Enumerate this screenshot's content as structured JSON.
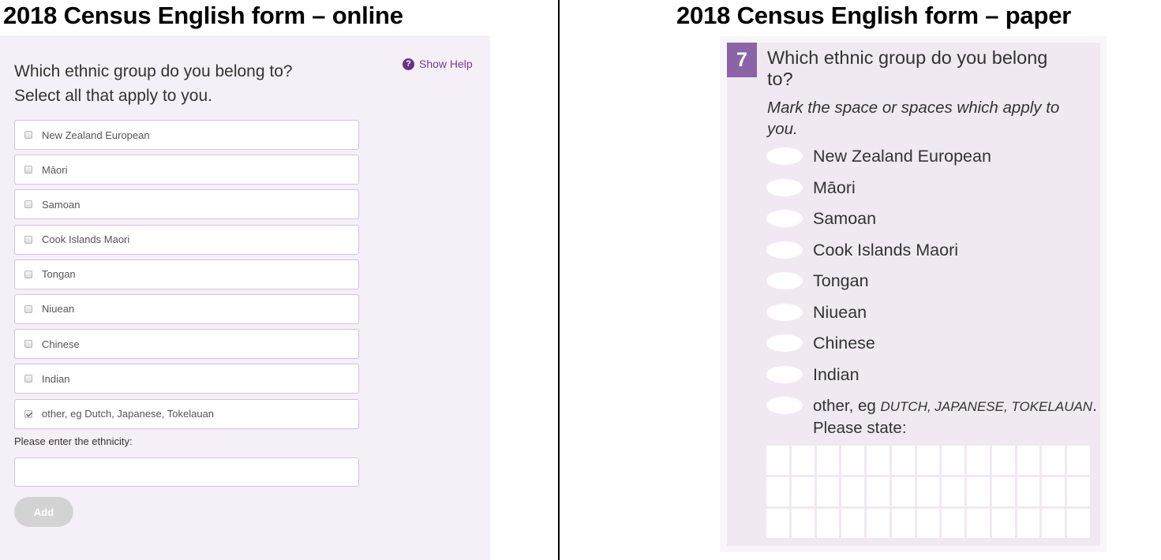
{
  "online": {
    "heading": "2018 Census English form – online",
    "question_line1": "Which ethnic group do you belong to?",
    "question_line2": "Select all that apply to you.",
    "help_label": "Show Help",
    "help_icon": "question-circle-icon",
    "options": [
      {
        "label": "New Zealand European",
        "checked": false
      },
      {
        "label": "Māori",
        "checked": false
      },
      {
        "label": "Samoan",
        "checked": false
      },
      {
        "label": "Cook Islands Maori",
        "checked": false
      },
      {
        "label": "Tongan",
        "checked": false
      },
      {
        "label": "Niuean",
        "checked": false
      },
      {
        "label": "Chinese",
        "checked": false
      },
      {
        "label": "Indian",
        "checked": false
      },
      {
        "label": "other, eg Dutch, Japanese, Tokelauan",
        "checked": true
      }
    ],
    "enter_label": "Please enter the ethnicity:",
    "ethnicity_value": "",
    "ethnicity_placeholder": "",
    "add_button": "Add",
    "colors": {
      "background": "#f5f0f7",
      "accent": "#6b2f8a",
      "border": "#d7c2e0",
      "button_disabled": "#d3d3d3"
    }
  },
  "paper": {
    "heading": "2018 Census English form – paper",
    "question_number": "7",
    "question": "Which ethnic group do you belong to?",
    "instruction": "Mark the space or spaces which apply to you.",
    "options": [
      "New Zealand European",
      "Māori",
      "Samoan",
      "Cook Islands Maori",
      "Tongan",
      "Niuean",
      "Chinese",
      "Indian"
    ],
    "other_prefix": "other, eg ",
    "other_examples": "DUTCH, JAPANESE, TOKELAUAN",
    "other_suffix": ". Please state:",
    "answer_grid": {
      "columns": 13,
      "rows": 3
    },
    "colors": {
      "background": "#f1e9f2",
      "number_badge": "#8a64a6"
    }
  }
}
